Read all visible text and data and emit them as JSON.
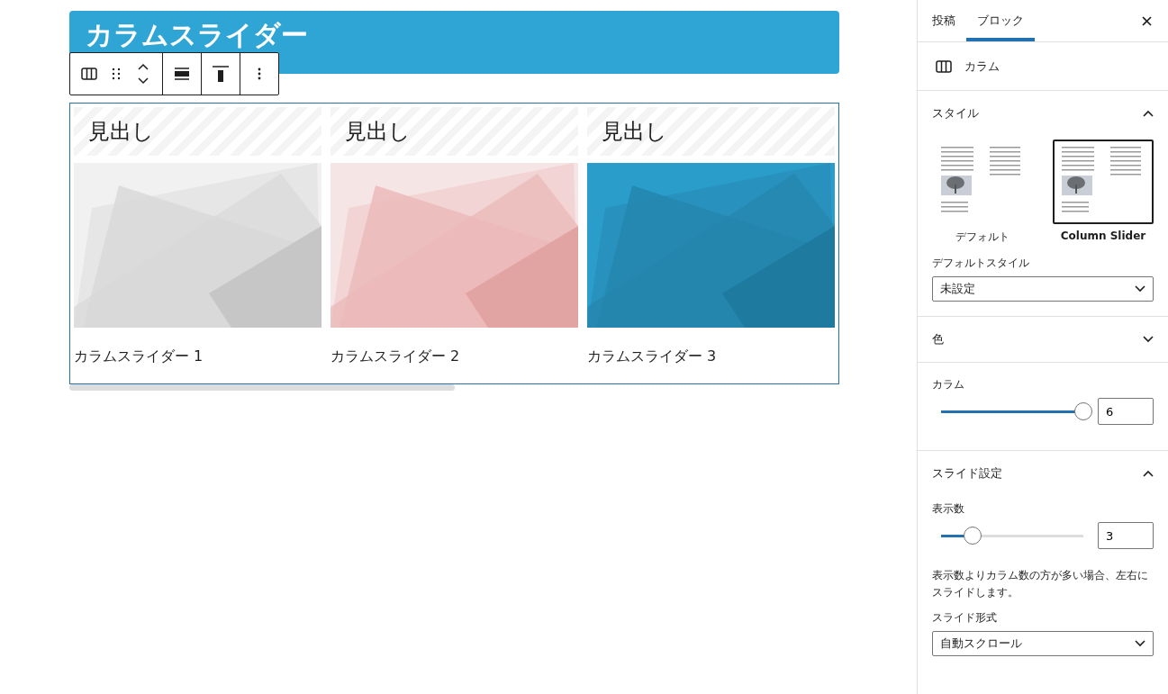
{
  "editor": {
    "title_block": {
      "text": "カラムスライダー"
    },
    "toolbar": {
      "groups": [
        [
          {
            "kind": "columns"
          },
          {
            "kind": "drag"
          },
          {
            "kind": "move"
          }
        ],
        [
          {
            "kind": "align"
          }
        ],
        [
          {
            "kind": "valign"
          }
        ],
        [
          {
            "kind": "more"
          }
        ]
      ]
    },
    "slider_selected": true,
    "slides": [
      {
        "heading": "見出し",
        "caption": "カラムスライダー 1"
      },
      {
        "heading": "見出し",
        "caption": "カラムスライダー 2"
      },
      {
        "heading": "見出し",
        "caption": "カラムスライダー 3"
      }
    ]
  },
  "sidebar": {
    "tabs": [
      {
        "label": "投稿",
        "selected": false
      },
      {
        "label": "ブロック",
        "selected": true
      }
    ],
    "block": {
      "name": "カラム"
    },
    "panels": [
      {
        "kind": "styles",
        "title": "スタイル",
        "expanded": true,
        "styles": [
          {
            "label": "デフォルト",
            "selected": false
          },
          {
            "label": "Column Slider",
            "selected": true
          }
        ],
        "select_label": "デフォルトスタイル",
        "select_value": "未設定"
      },
      {
        "kind": "plain",
        "title": "色",
        "expanded": false
      },
      {
        "kind": "range",
        "label": "カラム",
        "level": 1,
        "value": "6"
      },
      {
        "kind": "slide",
        "title": "スライド設定",
        "expanded": true,
        "range_label": "表示数",
        "level": 0.22,
        "value": "3",
        "help": "表示数よりカラム数の方が多い場合、左右にスライドします。",
        "select_label": "スライド形式",
        "select_value": "自動スクロール"
      }
    ]
  }
}
